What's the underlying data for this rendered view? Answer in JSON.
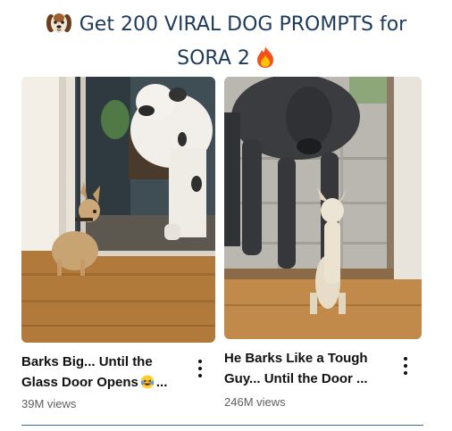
{
  "headline": {
    "line1": "Get 200 VIRAL DOG PROMPTS for",
    "line2": "SORA 2"
  },
  "icons": {
    "headline_left": "dog-face-icon",
    "headline_right": "fire-icon",
    "video1_title": "laughing-face-icon",
    "menu": "more-vertical-icon"
  },
  "videos": [
    {
      "title_line1": "Barks Big... Until the",
      "title_line2": "Glass Door Opens",
      "title_line2_tail": "...",
      "views": "39M views"
    },
    {
      "title_line1": "He Barks Like a Tough",
      "title_line2": "Guy... Until the Door ...",
      "views": "246M views"
    }
  ],
  "colors": {
    "headline": "#1d3a5c",
    "views": "#606060",
    "divider": "#3a6a9a"
  }
}
